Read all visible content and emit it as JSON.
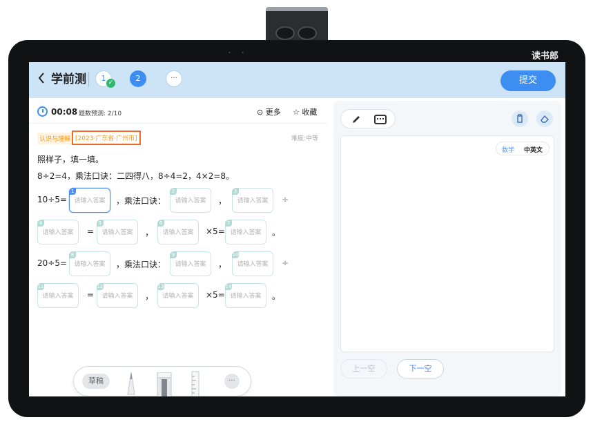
{
  "device": {
    "brand": "读书郎"
  },
  "header": {
    "back_icon": "chevron-left-icon",
    "title": "学前测",
    "questions": [
      {
        "label": "1",
        "state": "answered"
      },
      {
        "label": "2",
        "state": "current"
      },
      {
        "label": "···",
        "state": "more"
      }
    ],
    "submit_label": "提交"
  },
  "question": {
    "timer": "00:08",
    "progress": "题数预测: 2/10",
    "more_label": "更多",
    "favorite_label": "收藏",
    "topic_tag": "认识与理解",
    "source_tag": "[2023·广东省·广州市]",
    "difficulty": "难度:中等",
    "instruction": "照样子，填一填。",
    "example": "8÷2=4，乘法口诀：二四得八，8÷4=2，4×2=8。",
    "row1_prefix": "10÷5=",
    "row3_prefix": "20÷5=",
    "mult_text": "，乘法口诀：",
    "comma": "，",
    "div_sign": "÷",
    "eq_sign": "=",
    "times5": "×5=",
    "period": "。",
    "placeholder": "请输入答案",
    "blanks": [
      "1",
      "2",
      "3",
      "4",
      "5",
      "6",
      "7",
      "8",
      "9",
      "10",
      "11",
      "12",
      "13",
      "14"
    ]
  },
  "toolbar": {
    "draft_label": "草稿",
    "more_label": "···"
  },
  "answer_panel": {
    "lang_math": "数学",
    "lang_cn_en": "中英文",
    "prev_label": "上一空",
    "next_label": "下一空"
  },
  "colors": {
    "accent": "#3d8ef0",
    "header_bg": "#cde4f7",
    "tag_orange": "#f39a1f",
    "source_border": "#ef6a25",
    "check_green": "#2fb86b"
  }
}
